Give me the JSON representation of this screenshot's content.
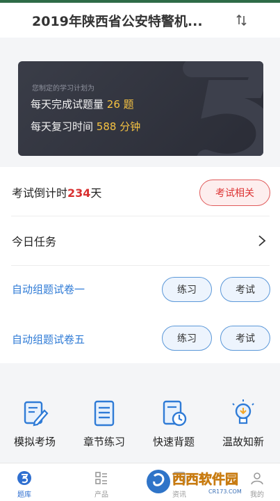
{
  "header": {
    "title": "2019年陕西省公安特警机..."
  },
  "plan": {
    "caption": "您制定的学习计划为",
    "line1_prefix": "每天完成试题量",
    "line1_value": "26",
    "line1_unit": "题",
    "line2_prefix": "每天复习时间",
    "line2_value": "588",
    "line2_unit": "分钟"
  },
  "countdown": {
    "prefix": "考试倒计时",
    "days": "234",
    "suffix": "天",
    "button": "考试相关"
  },
  "today": {
    "label": "今日任务"
  },
  "papers": [
    {
      "title": "自动组题试卷一",
      "practice": "练习",
      "exam": "考试"
    },
    {
      "title": "自动组题试卷五",
      "practice": "练习",
      "exam": "考试"
    }
  ],
  "tools": [
    {
      "label": "模拟考场",
      "icon": "exam-paper-icon"
    },
    {
      "label": "章节练习",
      "icon": "chapter-list-icon"
    },
    {
      "label": "快速背题",
      "icon": "quick-memorize-icon"
    },
    {
      "label": "温故知新",
      "icon": "lightbulb-icon"
    }
  ],
  "tabs": [
    {
      "label": "题库",
      "icon": "question-bank-icon"
    },
    {
      "label": "产品",
      "icon": "product-grid-icon"
    },
    {
      "label": "资讯",
      "icon": "news-icon"
    },
    {
      "label": "我的",
      "icon": "profile-icon"
    }
  ],
  "watermark": {
    "text1": "西西软件园",
    "text2": "CR173.COM"
  },
  "colors": {
    "accent_blue": "#2f7bd6",
    "countdown_red": "#d83030",
    "plan_highlight": "#f5c242",
    "top_bar": "#2e6b47"
  }
}
